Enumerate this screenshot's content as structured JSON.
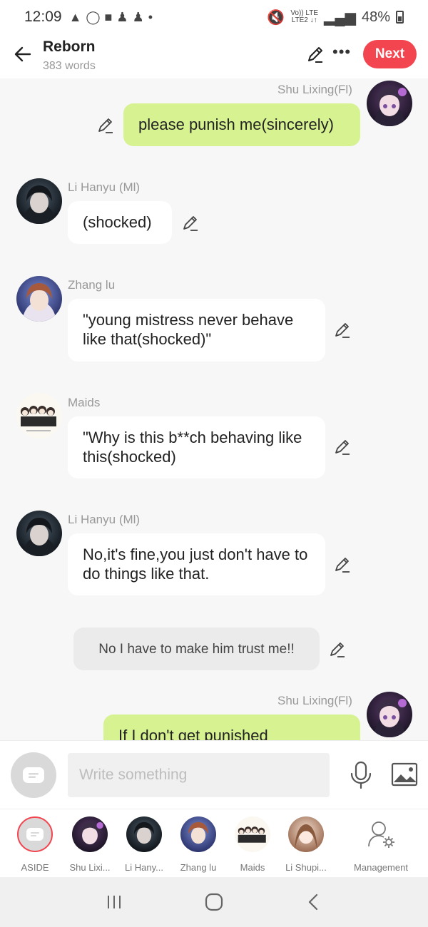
{
  "status": {
    "time": "12:09",
    "left_icons": [
      "warning-icon",
      "whatsapp-icon",
      "message-icon",
      "snapchat-icon",
      "snapchat-icon",
      "dot-icon"
    ],
    "net_top": "Vo)) LTE",
    "net_bottom": "LTE2 ↓↑",
    "battery": "48%"
  },
  "header": {
    "title": "Reborn",
    "subtitle": "383 words",
    "next_label": "Next",
    "accent": "#f2454f"
  },
  "messages": [
    {
      "id": "m1",
      "sender": "Shu Lixing(Fl)",
      "text": "please punish me(sincerely)",
      "side": "right",
      "avatar": "girl-purple"
    },
    {
      "id": "m2",
      "sender": "Li Hanyu (Ml)",
      "text": "(shocked)",
      "side": "left",
      "avatar": "boy-dark"
    },
    {
      "id": "m3",
      "sender": "Zhang lu",
      "text": "\"young mistress never behave like that(shocked)\"",
      "side": "left",
      "avatar": "boy-blue"
    },
    {
      "id": "m4",
      "sender": "Maids",
      "text": "\"Why is this b**ch behaving like this(shocked)",
      "side": "left",
      "avatar": "maids-group"
    },
    {
      "id": "m5",
      "sender": "Li Hanyu (Ml)",
      "text": "No,it's fine,you just don't have to do things like that.",
      "side": "left",
      "avatar": "boy-dark"
    },
    {
      "id": "m6",
      "sender": "",
      "text": "No I have to make him trust me!!",
      "side": "aside"
    },
    {
      "id": "m7",
      "sender": "Shu Lixing(Fl)",
      "text": "If I don't get punished",
      "side": "right",
      "avatar": "girl-purple"
    }
  ],
  "composer": {
    "placeholder": "Write something",
    "value": ""
  },
  "characters": [
    {
      "label": "ASIDE",
      "avatar": "aside-icon"
    },
    {
      "label": "Shu Lixi...",
      "avatar": "girl-purple"
    },
    {
      "label": "Li Hany...",
      "avatar": "boy-dark"
    },
    {
      "label": "Zhang lu",
      "avatar": "boy-blue"
    },
    {
      "label": "Maids",
      "avatar": "maids-group"
    },
    {
      "label": "Li Shupi...",
      "avatar": "girl-brown"
    },
    {
      "label": "Management",
      "avatar": "manage-icon"
    }
  ],
  "colors": {
    "my_bubble": "#d6f291",
    "their_bubble": "#ffffff",
    "aside_bubble": "#ebebeb",
    "background": "#f7f7f7"
  }
}
